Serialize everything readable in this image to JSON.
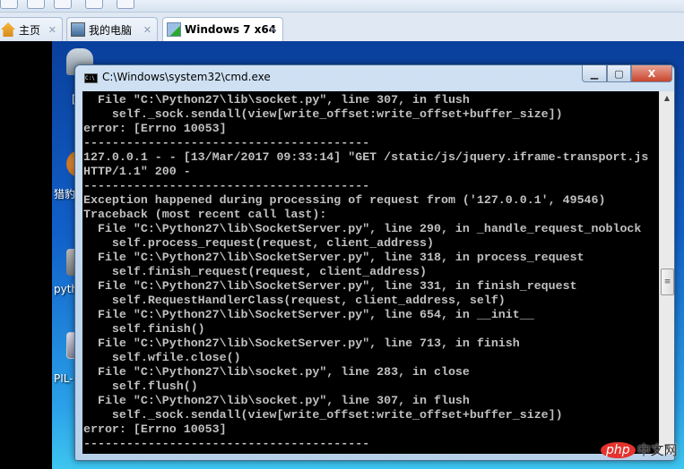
{
  "tabs": [
    {
      "label": "主页",
      "icon": "home-icon",
      "active": false
    },
    {
      "label": "我的电脑",
      "icon": "computer-icon",
      "active": false
    },
    {
      "label": "Windows 7 x64",
      "icon": "vm-running-icon",
      "active": true
    }
  ],
  "desktop": {
    "icons": [
      {
        "label": "[",
        "icon": "recycle-bin-icon"
      },
      {
        "label": "猎豹",
        "icon": "browser-icon"
      },
      {
        "label": "pyth",
        "icon": "recycle-icon"
      },
      {
        "label": "PIL-",
        "icon": "installer-icon"
      }
    ]
  },
  "cmd": {
    "title": "C:\\Windows\\system32\\cmd.exe",
    "lines": [
      "  File \"C:\\Python27\\lib\\socket.py\", line 307, in flush",
      "    self._sock.sendall(view[write_offset:write_offset+buffer_size])",
      "error: [Errno 10053]",
      "----------------------------------------",
      "127.0.0.1 - - [13/Mar/2017 09:33:14] \"GET /static/js/jquery.iframe-transport.js",
      "HTTP/1.1\" 200 -",
      "----------------------------------------",
      "Exception happened during processing of request from ('127.0.0.1', 49546)",
      "Traceback (most recent call last):",
      "  File \"C:\\Python27\\lib\\SocketServer.py\", line 290, in _handle_request_noblock",
      "    self.process_request(request, client_address)",
      "  File \"C:\\Python27\\lib\\SocketServer.py\", line 318, in process_request",
      "    self.finish_request(request, client_address)",
      "  File \"C:\\Python27\\lib\\SocketServer.py\", line 331, in finish_request",
      "    self.RequestHandlerClass(request, client_address, self)",
      "  File \"C:\\Python27\\lib\\SocketServer.py\", line 654, in __init__",
      "    self.finish()",
      "  File \"C:\\Python27\\lib\\SocketServer.py\", line 713, in finish",
      "    self.wfile.close()",
      "  File \"C:\\Python27\\lib\\socket.py\", line 283, in close",
      "    self.flush()",
      "  File \"C:\\Python27\\lib\\socket.py\", line 307, in flush",
      "    self._sock.sendall(view[write_offset:write_offset+buffer_size])",
      "error: [Errno 10053]",
      "----------------------------------------"
    ],
    "scroll_position_percent": 50
  },
  "watermark": {
    "text": "php中文网",
    "p": "php",
    "c": "中文网"
  },
  "colors": {
    "console_bg": "#000000",
    "console_fg": "#c0c0c0",
    "desktop": "#1160c8"
  }
}
